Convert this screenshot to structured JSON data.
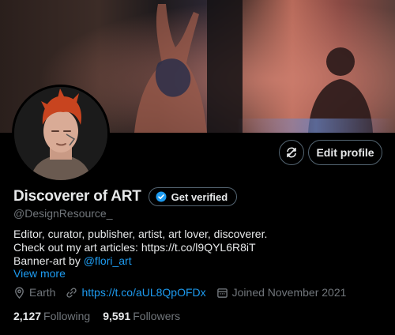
{
  "banner": {
    "description_colors": [
      "#2a1f1c",
      "#b86a5a",
      "#5a7ab0"
    ]
  },
  "actions": {
    "icon_button_icon": "sync-icon",
    "edit_profile_label": "Edit profile"
  },
  "profile": {
    "display_name": "Discoverer of ART",
    "get_verified_label": "Get verified",
    "handle": "@DesignResource_",
    "bio_line1": "Editor, curator, publisher, artist, art lover, discoverer.",
    "bio_line2": "Check out my art articles: https://t.co/l9QYL6R8iT",
    "bio_line3_prefix": "Banner-art by ",
    "bio_line3_mention": "@flori_art",
    "view_more": "View more",
    "location": "Earth",
    "website": "https://t.co/aUL8QpOFDx",
    "joined": "Joined November 2021",
    "following_count": "2,127",
    "following_label": "Following",
    "followers_count": "9,591",
    "followers_label": "Followers"
  },
  "colors": {
    "accent": "#1d9bf0",
    "muted": "#71767b",
    "text": "#e7e9ea",
    "border": "#536471"
  }
}
